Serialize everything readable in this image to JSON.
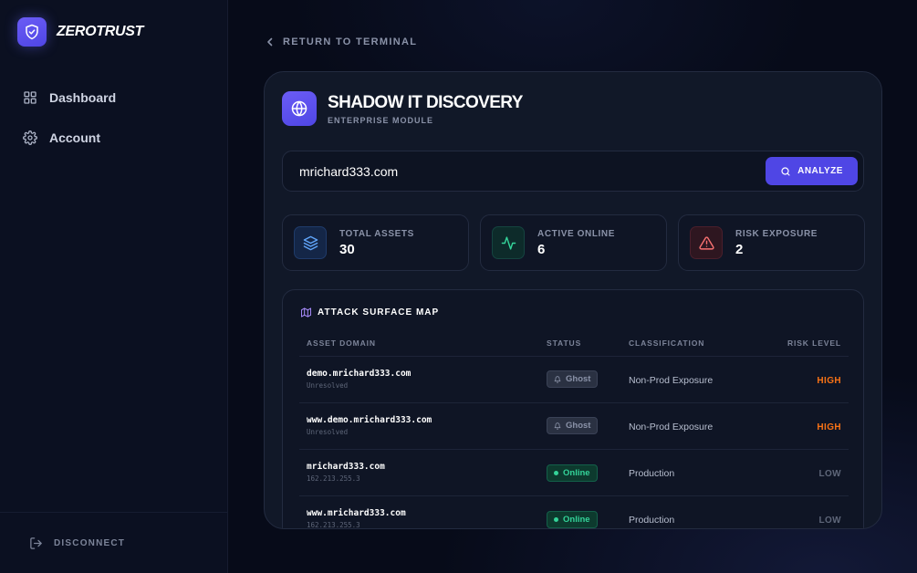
{
  "brand": {
    "name": "ZEROTRUST"
  },
  "sidebar": {
    "items": [
      {
        "label": "Dashboard",
        "icon": "grid-icon"
      },
      {
        "label": "Account",
        "icon": "gear-icon"
      }
    ],
    "footer": {
      "label": "DISCONNECT",
      "icon": "logout-icon"
    }
  },
  "nav": {
    "return_label": "RETURN TO TERMINAL"
  },
  "module": {
    "title": "SHADOW IT DISCOVERY",
    "subtitle": "ENTERPRISE MODULE",
    "icon": "globe-icon"
  },
  "search": {
    "value": "mrichard333.com",
    "button_label": "ANALYZE"
  },
  "stats": [
    {
      "label": "TOTAL ASSETS",
      "value": "30",
      "icon": "layers-icon"
    },
    {
      "label": "ACTIVE ONLINE",
      "value": "6",
      "icon": "activity-icon"
    },
    {
      "label": "RISK EXPOSURE",
      "value": "2",
      "icon": "warning-icon"
    }
  ],
  "map": {
    "title": "ATTACK SURFACE MAP",
    "columns": [
      "ASSET DOMAIN",
      "STATUS",
      "CLASSIFICATION",
      "RISK LEVEL"
    ],
    "rows": [
      {
        "domain": "demo.mrichard333.com",
        "sub": "Unresolved",
        "status": "Ghost",
        "classification": "Non-Prod Exposure",
        "risk": "HIGH"
      },
      {
        "domain": "www.demo.mrichard333.com",
        "sub": "Unresolved",
        "status": "Ghost",
        "classification": "Non-Prod Exposure",
        "risk": "HIGH"
      },
      {
        "domain": "mrichard333.com",
        "sub": "162.213.255.3",
        "status": "Online",
        "classification": "Production",
        "risk": "LOW"
      },
      {
        "domain": "www.mrichard333.com",
        "sub": "162.213.255.3",
        "status": "Online",
        "classification": "Production",
        "risk": "LOW"
      }
    ]
  },
  "colors": {
    "accent": "#4f46e5",
    "online": "#34d399",
    "high": "#f97316",
    "background": "#070b19"
  }
}
